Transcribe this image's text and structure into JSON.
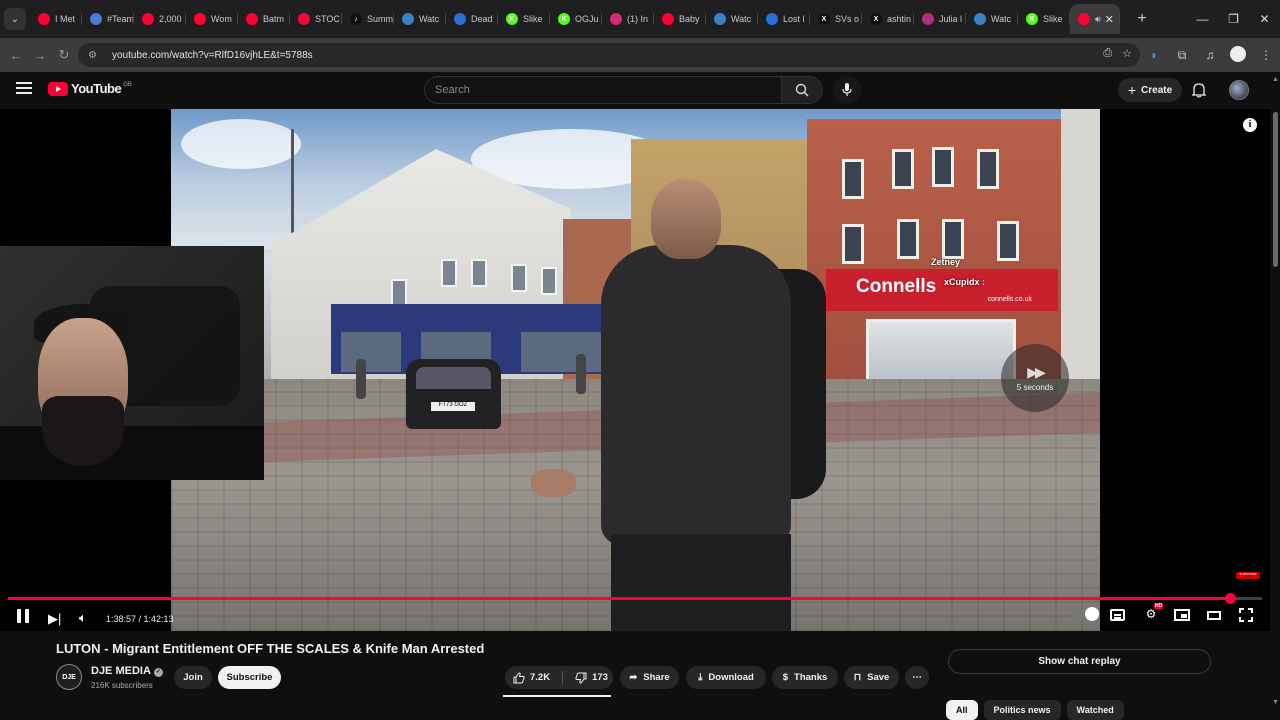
{
  "browser": {
    "tabs": [
      {
        "label": "I Met",
        "color": "#ff0033",
        "glyph": ""
      },
      {
        "label": "#Team",
        "color": "#4a7bd0",
        "glyph": ""
      },
      {
        "label": "2,000",
        "color": "#ff0033",
        "glyph": ""
      },
      {
        "label": "Wom",
        "color": "#ff0033",
        "glyph": ""
      },
      {
        "label": "Batm",
        "color": "#ff0033",
        "glyph": ""
      },
      {
        "label": "STOC",
        "color": "#ff0033",
        "glyph": ""
      },
      {
        "label": "Summ",
        "color": "#111111",
        "glyph": "♪"
      },
      {
        "label": "Watc",
        "color": "#3b82c4",
        "glyph": ""
      },
      {
        "label": "Dead",
        "color": "#2a6fd6",
        "glyph": ""
      },
      {
        "label": "Slike",
        "color": "#53fc18",
        "glyph": "K"
      },
      {
        "label": "OGJu",
        "color": "#53fc18",
        "glyph": "K"
      },
      {
        "label": "(1) In",
        "color": "#d62976",
        "glyph": ""
      },
      {
        "label": "Baby",
        "color": "#ff0033",
        "glyph": ""
      },
      {
        "label": "Watc",
        "color": "#3b82c4",
        "glyph": ""
      },
      {
        "label": "Lost l",
        "color": "#2a6fd6",
        "glyph": ""
      },
      {
        "label": "SVs o",
        "color": "#111111",
        "glyph": "X"
      },
      {
        "label": "ashtin",
        "color": "#111111",
        "glyph": "X"
      },
      {
        "label": "Julia l",
        "color": "#b03080",
        "glyph": ""
      },
      {
        "label": "Watc",
        "color": "#3b82c4",
        "glyph": ""
      },
      {
        "label": "Slike",
        "color": "#53fc18",
        "glyph": "K"
      }
    ],
    "active_tab_close": "✕",
    "new_tab": "+",
    "window_controls": [
      "—",
      "❐",
      "✕"
    ],
    "url": "youtube.com/watch?v=RlfD16vjhLE&t=5788s",
    "nav": [
      "←",
      "→",
      "↻"
    ]
  },
  "youtube": {
    "logo_text": "YouTube",
    "country_code": "GB",
    "search_placeholder": "Search",
    "create_label": "Create"
  },
  "video": {
    "shop_sign": "Connells",
    "shop_url": "connells.co.uk",
    "overlay_user1": "Zetney",
    "overlay_user2": "xCupidx :",
    "skip_label": "5 seconds",
    "plate": "FT73 GOZ",
    "progress_fraction": 0.9747,
    "time_display": "1:38:57 / 1:42:13",
    "subscribe_watermark": "SUBSCRIBE",
    "accent": "#ff0033"
  },
  "meta": {
    "title": "LUTON - Migrant Entitlement OFF THE SCALES & Knife Man Arrested",
    "channel_initials": "DJE",
    "channel_name": "DJE MEDIA",
    "subscribers": "216K subscribers",
    "join": "Join",
    "subscribe": "Subscribe",
    "likes": "7.2K",
    "dislikes": "173",
    "share": "Share",
    "download": "Download",
    "thanks": "Thanks",
    "save": "Save",
    "more": "⋯",
    "chat_replay": "Show chat replay",
    "chips": [
      "All",
      "Politics news",
      "Watched"
    ]
  }
}
